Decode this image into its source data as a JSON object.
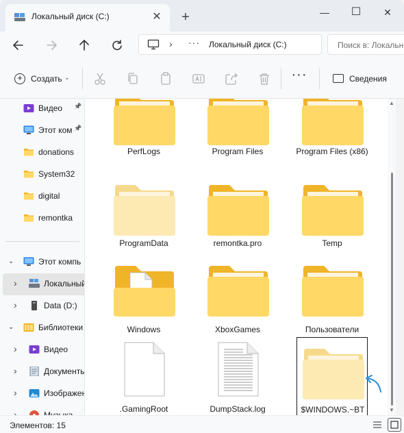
{
  "window": {
    "tab_title": "Локальный диск (C:)",
    "tab_close": "✕",
    "new_tab": "+",
    "minimize": "—",
    "maximize": "☐",
    "close": "✕"
  },
  "navigation": {
    "back_icon": "arrow-left-icon",
    "forward_icon": "arrow-right-icon",
    "up_icon": "arrow-up-icon",
    "refresh_icon": "refresh-icon",
    "address_separator": "›",
    "address_overflow": "···",
    "address_path": "Локальный диск (C:)",
    "search_placeholder": "Поиск в: Локальн"
  },
  "commandbar": {
    "create_label": "Создать",
    "create_chevron": "⌄",
    "more": "···",
    "details_label": "Сведения",
    "disabled_icons": [
      "cut-icon",
      "copy-icon",
      "paste-icon",
      "rename-icon",
      "share-icon",
      "delete-icon"
    ]
  },
  "sidebar": {
    "items": [
      {
        "label": "Видео",
        "icon": "video-icon",
        "pinned": true
      },
      {
        "label": "Этот ком",
        "icon": "monitor-icon",
        "pinned": true
      },
      {
        "label": "donations",
        "icon": "folder-icon"
      },
      {
        "label": "System32",
        "icon": "folder-icon"
      },
      {
        "label": "digital",
        "icon": "folder-icon"
      },
      {
        "label": "remontka",
        "icon": "folder-icon"
      },
      {
        "label": "Этот компь",
        "icon": "monitor-icon",
        "expanded": true
      },
      {
        "label": "Локальный",
        "icon": "drive-c-icon",
        "selected": true
      },
      {
        "label": "Data (D:)",
        "icon": "drive-icon"
      },
      {
        "label": "Библиотеки",
        "icon": "library-icon",
        "expanded": true
      },
      {
        "label": "Видео",
        "icon": "video-icon"
      },
      {
        "label": "Документы",
        "icon": "documents-icon"
      },
      {
        "label": "Изображения",
        "icon": "pictures-icon"
      },
      {
        "label": "Музыка",
        "icon": "music-icon"
      }
    ]
  },
  "files": [
    {
      "name": "PerfLogs",
      "type": "folder"
    },
    {
      "name": "Program Files",
      "type": "folder"
    },
    {
      "name": "Program Files (x86)",
      "type": "folder"
    },
    {
      "name": "ProgramData",
      "type": "folder-hidden"
    },
    {
      "name": "remontka.pro",
      "type": "folder"
    },
    {
      "name": "Temp",
      "type": "folder"
    },
    {
      "name": "Windows",
      "type": "folder-doc"
    },
    {
      "name": "XboxGames",
      "type": "folder"
    },
    {
      "name": "Пользователи",
      "type": "folder"
    },
    {
      "name": ".GamingRoot",
      "type": "file"
    },
    {
      "name": "DumpStack.log",
      "type": "file-text"
    },
    {
      "name": "$WINDOWS.~BT",
      "type": "folder-hidden",
      "focused": true
    }
  ],
  "statusbar": {
    "items_count": "Элементов: 15"
  },
  "colors": {
    "folder_back": "#f0b429",
    "folder_front": "#ffd866",
    "folder_hidden_back": "#f7d98b",
    "folder_hidden_front": "#fde9b2",
    "annotation_arrow": "#2a8fd6",
    "selection_bg": "#e5e5e5"
  }
}
